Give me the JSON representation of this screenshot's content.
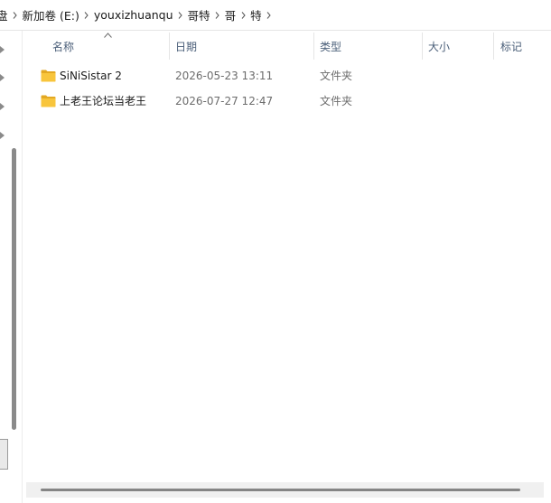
{
  "breadcrumb": [
    {
      "label": "盘",
      "partial": true
    },
    {
      "label": "新加卷 (E:)"
    },
    {
      "label": "youxizhuanqu"
    },
    {
      "label": "哥特"
    },
    {
      "label": "哥"
    },
    {
      "label": "特"
    }
  ],
  "columns": {
    "name": "名称",
    "date": "日期",
    "type": "类型",
    "size": "大小",
    "tags": "标记"
  },
  "sort": {
    "column": "name",
    "direction": "ascending"
  },
  "files": [
    {
      "name": "SiNiSistar 2",
      "date": "2026-05-23 13:11",
      "type": "文件夹",
      "icon": "folder-icon"
    },
    {
      "name": "上老王论坛当老王",
      "date": "2026-07-27 12:47",
      "type": "文件夹",
      "icon": "folder-icon"
    }
  ],
  "colors": {
    "folder": "#f8c53c",
    "folder_dark": "#e3a823",
    "header_text": "#4c607a",
    "secondary_text": "#6d6d6d"
  }
}
